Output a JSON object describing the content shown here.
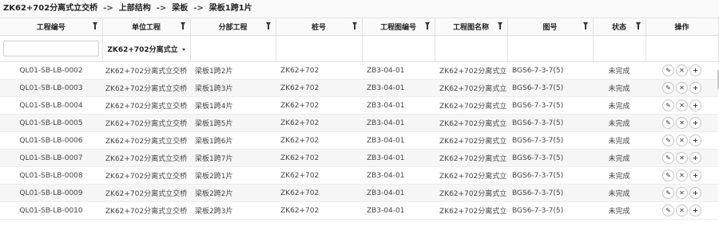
{
  "breadcrumb": [
    "ZK62+702分离式立交桥",
    "上部结构",
    "梁板",
    "梁板1跨1片"
  ],
  "breadcrumb_separator": "->",
  "columns": [
    "工程编号",
    "单位工程",
    "分部工程",
    "桩号",
    "工程图编号",
    "工程图名称",
    "图号",
    "状态",
    "操作"
  ],
  "filter": {
    "unit_project_selected": "ZK62+702分离式立"
  },
  "rows": [
    {
      "code": "QL01-SB-LB-0002",
      "unit": "ZK62+702分离式立交桥",
      "part": "梁板1跨2片",
      "station": "ZK62+702",
      "drawing_no": "ZB3-04-01",
      "drawing_name": "ZK62+702分离式立",
      "figure_no": "BGS6-7-3-7(5)",
      "status": "未完成"
    },
    {
      "code": "QL01-SB-LB-0003",
      "unit": "ZK62+702分离式立交桥",
      "part": "梁板1跨3片",
      "station": "ZK62+702",
      "drawing_no": "ZB3-04-01",
      "drawing_name": "ZK62+702分离式立",
      "figure_no": "BGS6-7-3-7(5)",
      "status": "未完成"
    },
    {
      "code": "QL01-SB-LB-0004",
      "unit": "ZK62+702分离式立交桥",
      "part": "梁板1跨4片",
      "station": "ZK62+702",
      "drawing_no": "ZB3-04-01",
      "drawing_name": "ZK62+702分离式立",
      "figure_no": "BGS6-7-3-7(5)",
      "status": "未完成"
    },
    {
      "code": "QL01-SB-LB-0005",
      "unit": "ZK62+702分离式立交桥",
      "part": "梁板1跨5片",
      "station": "ZK62+702",
      "drawing_no": "ZB3-04-01",
      "drawing_name": "ZK62+702分离式立",
      "figure_no": "BGS6-7-3-7(5)",
      "status": "未完成"
    },
    {
      "code": "QL01-SB-LB-0006",
      "unit": "ZK62+702分离式立交桥",
      "part": "梁板1跨6片",
      "station": "ZK62+702",
      "drawing_no": "ZB3-04-01",
      "drawing_name": "ZK62+702分离式立",
      "figure_no": "BGS6-7-3-7(5)",
      "status": "未完成"
    },
    {
      "code": "QL01-SB-LB-0007",
      "unit": "ZK62+702分离式立交桥",
      "part": "梁板1跨7片",
      "station": "ZK62+702",
      "drawing_no": "ZB3-04-01",
      "drawing_name": "ZK62+702分离式立",
      "figure_no": "BGS6-7-3-7(5)",
      "status": "未完成"
    },
    {
      "code": "QL01-SB-LB-0008",
      "unit": "ZK62+702分离式立交桥",
      "part": "梁板2跨1片",
      "station": "ZK62+702",
      "drawing_no": "ZB3-04-01",
      "drawing_name": "ZK62+702分离式立",
      "figure_no": "BGS6-7-3-7(5)",
      "status": "未完成"
    },
    {
      "code": "QL01-SB-LB-0009",
      "unit": "ZK62+702分离式立交桥",
      "part": "梁板2跨2片",
      "station": "ZK62+702",
      "drawing_no": "ZB3-04-01",
      "drawing_name": "ZK62+702分离式立",
      "figure_no": "BGS6-7-3-7(5)",
      "status": "未完成"
    },
    {
      "code": "QL01-SB-LB-0010",
      "unit": "ZK62+702分离式立交桥",
      "part": "梁板2跨3片",
      "station": "ZK62+702",
      "drawing_no": "ZB3-04-01",
      "drawing_name": "ZK62+702分离式立",
      "figure_no": "BGS6-7-3-7(5)",
      "status": "未完成"
    }
  ],
  "actions": {
    "edit": "✎",
    "delete": "✕",
    "add": "+"
  },
  "icons": {
    "edit": "pencil-icon",
    "delete": "close-icon",
    "add": "plus-icon",
    "filter": "filter-icon"
  }
}
